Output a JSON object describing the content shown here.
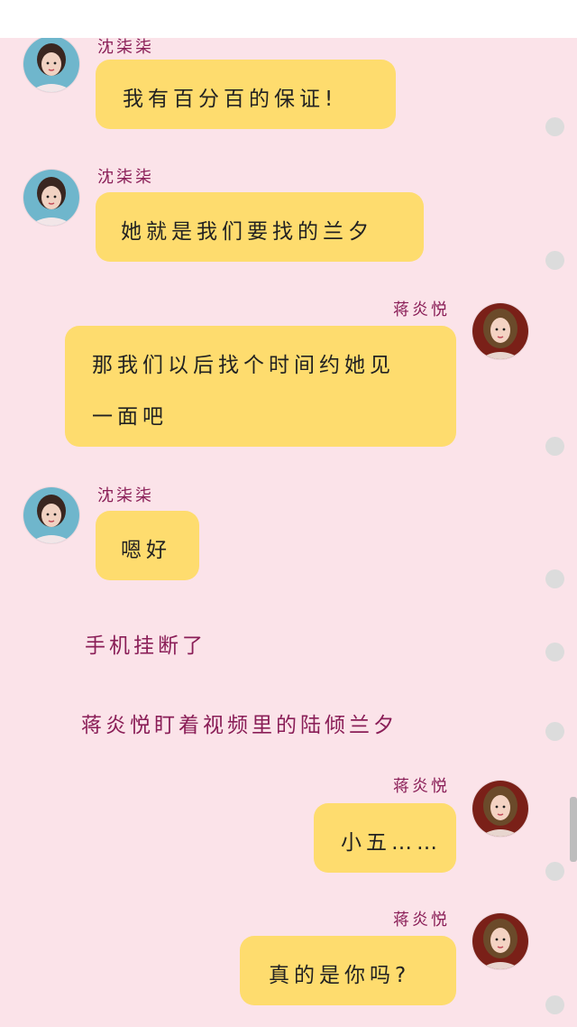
{
  "app": {
    "accent_color": "#fedc6e",
    "background_color": "#fbe3e9",
    "name_color": "#8a1e57"
  },
  "characters": {
    "left": {
      "name": "沈柒柒",
      "avatar_icon": "avatar-icon-shen"
    },
    "right": {
      "name": "蒋炎悦",
      "avatar_icon": "avatar-icon-jiang"
    }
  },
  "messages": [
    {
      "side": "left",
      "name": "沈柒柒",
      "text": "我有百分百的保证!"
    },
    {
      "side": "left",
      "name": "沈柒柒",
      "text": "她就是我们要找的兰夕"
    },
    {
      "side": "right",
      "name": "蒋炎悦",
      "line1": "那我们以后找个时间约她见",
      "line2": "一面吧"
    },
    {
      "side": "left",
      "name": "沈柒柒",
      "text": "嗯好"
    },
    {
      "side": "right",
      "name": "蒋炎悦",
      "text": "小五……"
    },
    {
      "side": "right",
      "name": "蒋炎悦",
      "text": "真的是你吗?"
    }
  ],
  "narrations": [
    {
      "text": "手机挂断了"
    },
    {
      "text": "蒋炎悦盯着视频里的陆倾兰夕"
    }
  ]
}
